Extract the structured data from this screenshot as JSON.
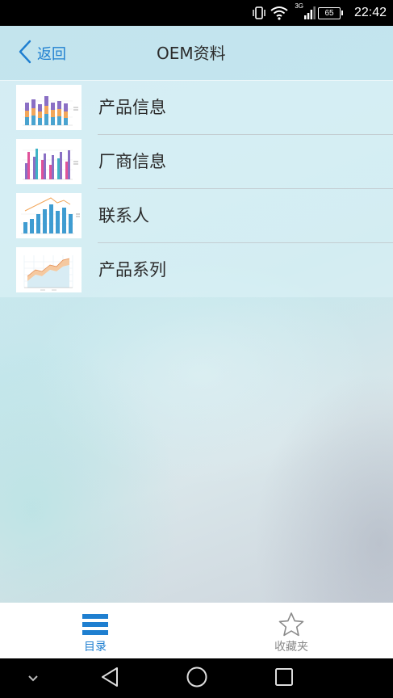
{
  "status_bar": {
    "time": "22:42",
    "battery_level": "65",
    "network_type": "3G"
  },
  "header": {
    "back_label": "返回",
    "title": "OEM资料"
  },
  "list": {
    "items": [
      {
        "label": "产品信息",
        "thumbnail": "stacked-bar-chart-thumbnail"
      },
      {
        "label": "厂商信息",
        "thumbnail": "grouped-bar-chart-thumbnail"
      },
      {
        "label": "联系人",
        "thumbnail": "bar-line-chart-thumbnail"
      },
      {
        "label": "产品系列",
        "thumbnail": "area-chart-thumbnail"
      }
    ]
  },
  "tabbar": {
    "tabs": [
      {
        "label": "目录",
        "icon": "menu-list-icon",
        "active": true
      },
      {
        "label": "收藏夹",
        "icon": "star-icon",
        "active": false
      }
    ]
  },
  "colors": {
    "accent": "#1f7fd0",
    "inactive_tab": "#8a8a8a"
  }
}
